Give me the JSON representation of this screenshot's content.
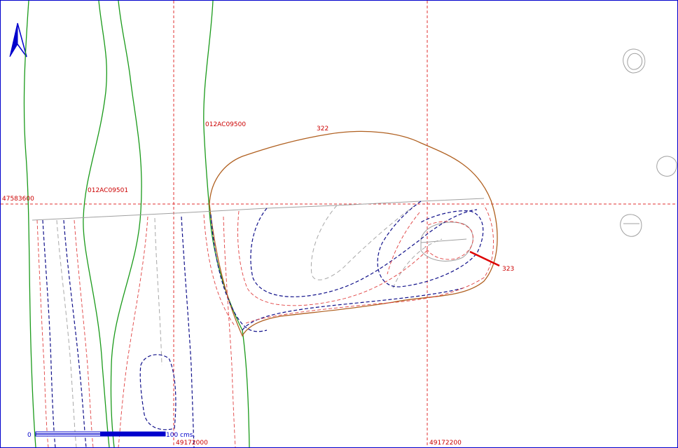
{
  "grid": {
    "northing_label": "47583600",
    "easting_labels": [
      "49172000",
      "49172200"
    ]
  },
  "features": {
    "pipe_a": "012AC09500",
    "pipe_b": "012AC09501",
    "contour_a": "322",
    "contour_b": "323"
  },
  "scale_bar": {
    "start": "0",
    "end": "100 cms."
  },
  "north_arrow": "north-arrow",
  "colors": {
    "grid": "#e03030",
    "boundary": "#1a9a1a",
    "outline": "#b06020",
    "contour_dark": "#10108a",
    "contour_red": "#e04040",
    "border": "#0000cc"
  }
}
